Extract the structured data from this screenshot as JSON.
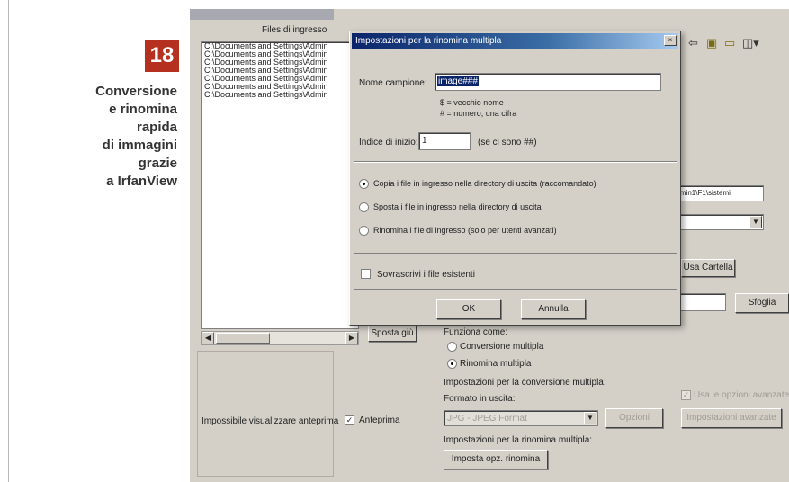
{
  "article": {
    "step_number": "18",
    "caption_lines": [
      "Conversione",
      "e rinomina",
      "rapida",
      "di immagini",
      "grazie",
      "a IrfanView"
    ]
  },
  "app": {
    "input_files_label": "Files di ingresso",
    "file_list": [
      "C:\\Documents and Settings\\Admin",
      "C:\\Documents and Settings\\Admin",
      "C:\\Documents and Settings\\Admin",
      "C:\\Documents and Settings\\Admin",
      "C:\\Documents and Settings\\Admin",
      "C:\\Documents and Settings\\Admin",
      "C:\\Documents and Settings\\Admin"
    ],
    "move_down_button": "Sposta giù",
    "work_as_label": "Funziona come:",
    "multiple_conversion_label": "Conversione multipla",
    "multiple_rename_label": "Rinomina multipla",
    "conversion_settings_label": "Impostazioni per la conversione multipla:",
    "output_format_label": "Formato in uscita:",
    "output_format_value": "JPG - JPEG Format",
    "options_button": "Opzioni",
    "use_advanced_label": "Usa le opzioni avanzate",
    "advanced_button": "Impostazioni avanzate",
    "rename_settings_label": "Impostazioni per la rinomina multipla:",
    "rename_options_button": "Imposta opz. rinomina",
    "no_preview_text": "Impossibile visualizzare anteprima",
    "preview_label": "Anteprima",
    "output_dir_value": "admin1\\F1\\sistemi",
    "use_current_dir_button": "Usa Cartella",
    "browse_button": "Sfoglia"
  },
  "dialog": {
    "title": "Impostazioni per la rinomina multipla",
    "close_label": "×",
    "name_pattern_label": "Nome campione:",
    "name_pattern_value": "image###",
    "hint_line1": "$ = vecchio nome",
    "hint_line2": "# = numero, una cifra",
    "start_index_label": "Indice di inizio:",
    "start_index_value": "1",
    "start_index_hint": "(se ci sono ##)",
    "radio_copy": "Copia i file in ingresso nella directory di uscita (raccomandato)",
    "radio_move": "Sposta i file in ingresso nella directory di uscita",
    "radio_rename": "Rinomina i file di ingresso (solo per utenti avanzati)",
    "overwrite_label": "Sovrascrivi i file esistenti",
    "ok_button": "OK",
    "cancel_button": "Annulla"
  }
}
